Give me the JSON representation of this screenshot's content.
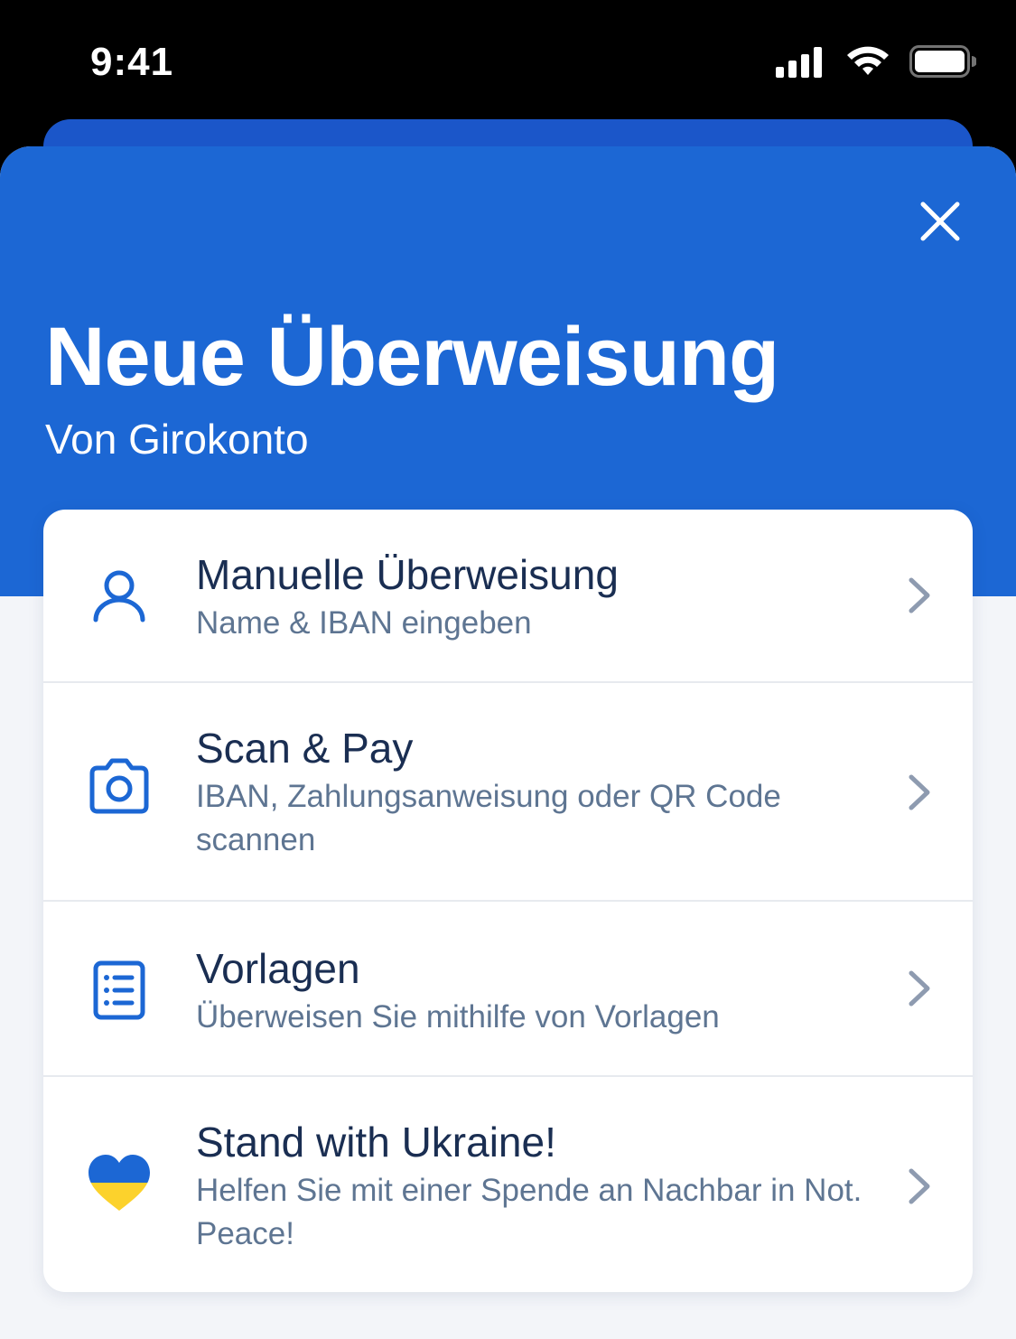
{
  "status_bar": {
    "time": "9:41"
  },
  "sheet": {
    "close_icon": "close-icon",
    "title": "Neue Überweisung",
    "subtitle": "Von Girokonto"
  },
  "options": [
    {
      "icon": "person-icon",
      "title": "Manuelle Überweisung",
      "description": "Name & IBAN eingeben"
    },
    {
      "icon": "camera-icon",
      "title": "Scan & Pay",
      "description": "IBAN, Zahlungsanweisung oder QR Code scannen"
    },
    {
      "icon": "list-icon",
      "title": "Vorlagen",
      "description": "Überweisen Sie mithilfe von Vorlagen"
    },
    {
      "icon": "ukraine-heart-icon",
      "title": "Stand with Ukraine!",
      "description": "Helfen Sie mit einer Spende an Nachbar in Not. Peace!"
    }
  ],
  "colors": {
    "header_blue": "#1c67d4",
    "back_sheet_blue": "#1b56c9",
    "icon_blue": "#1c67d4",
    "title_text": "#1a2e52",
    "description_text": "#5e7592",
    "chevron": "#8e9bb0",
    "flag_blue": "#1c67d4",
    "flag_yellow": "#fcd22c"
  }
}
